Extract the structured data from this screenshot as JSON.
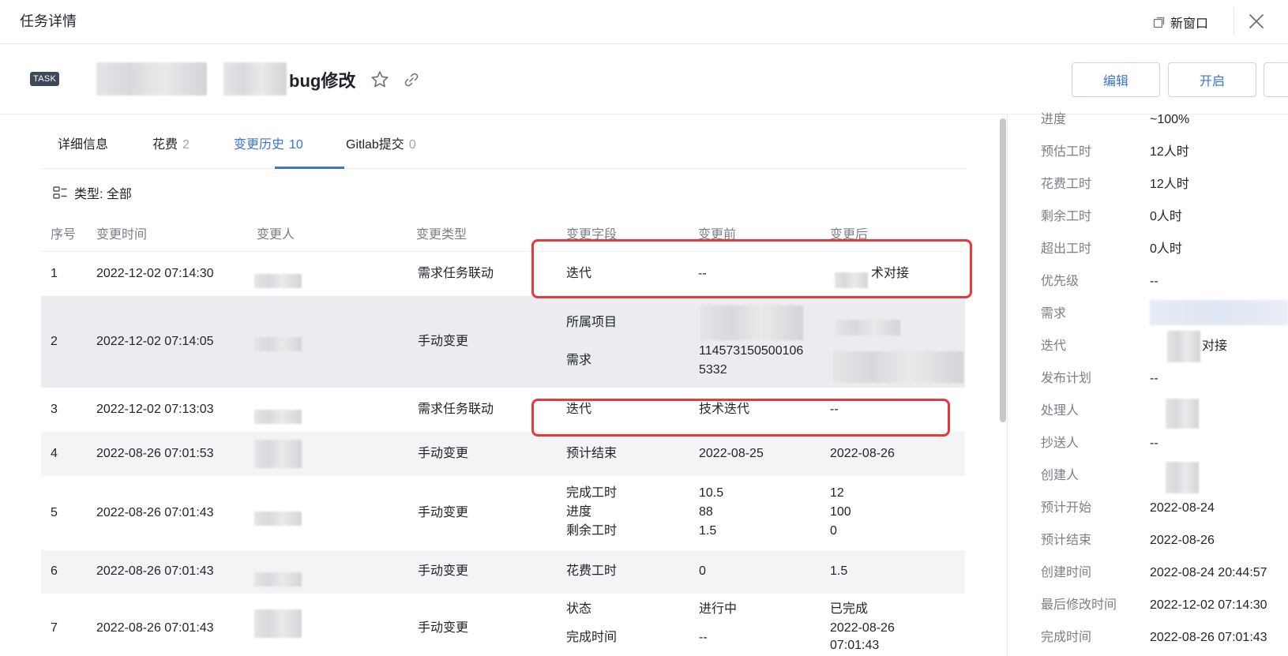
{
  "header": {
    "title": "任务详情",
    "new_window": "新窗口"
  },
  "task": {
    "tag": "TASK",
    "name_suffix": "bug修改"
  },
  "actions": {
    "edit": "编辑",
    "open": "开启"
  },
  "tabs": [
    {
      "label": "详细信息",
      "count": ""
    },
    {
      "label": "花费",
      "count": "2"
    },
    {
      "label": "变更历史",
      "count": "10"
    },
    {
      "label": "Gitlab提交",
      "count": "0"
    }
  ],
  "filter": {
    "label": "类型: 全部"
  },
  "table": {
    "headers": [
      "序号",
      "变更时间",
      "变更人",
      "变更类型",
      "变更字段",
      "变更前",
      "变更后"
    ],
    "rows": [
      {
        "no": "1",
        "time": "2022-12-02 07:14:30",
        "type": "需求任务联动",
        "fields": [
          "迭代"
        ],
        "before": [
          "--"
        ],
        "after": [
          "术对接"
        ]
      },
      {
        "no": "2",
        "time": "2022-12-02 07:14:05",
        "type": "手动变更",
        "fields": [
          "所属项目",
          "需求"
        ],
        "before": [
          "",
          "114573150500106",
          "5332"
        ],
        "after": [
          "",
          ""
        ]
      },
      {
        "no": "3",
        "time": "2022-12-02 07:13:03",
        "type": "需求任务联动",
        "fields": [
          "迭代"
        ],
        "before": [
          "技术迭代"
        ],
        "after": [
          "--"
        ]
      },
      {
        "no": "4",
        "time": "2022-08-26 07:01:53",
        "type": "手动变更",
        "fields": [
          "预计结束"
        ],
        "before": [
          "2022-08-25"
        ],
        "after": [
          "2022-08-26"
        ]
      },
      {
        "no": "5",
        "time": "2022-08-26 07:01:43",
        "type": "手动变更",
        "fields": [
          "完成工时",
          "进度",
          "剩余工时"
        ],
        "before": [
          "10.5",
          "88",
          "1.5"
        ],
        "after": [
          "12",
          "100",
          "0"
        ]
      },
      {
        "no": "6",
        "time": "2022-08-26 07:01:43",
        "type": "手动变更",
        "fields": [
          "花费工时"
        ],
        "before": [
          "0"
        ],
        "after": [
          "1.5"
        ]
      },
      {
        "no": "7",
        "time": "2022-08-26 07:01:43",
        "type": "手动变更",
        "fields": [
          "状态",
          "完成时间"
        ],
        "before": [
          "进行中",
          "--"
        ],
        "after": [
          "已完成",
          "2022-08-26",
          "07:01:43"
        ]
      }
    ]
  },
  "properties": [
    {
      "label": "进度",
      "value": "~100%"
    },
    {
      "label": "预估工时",
      "value": "12人时"
    },
    {
      "label": "花费工时",
      "value": "12人时"
    },
    {
      "label": "剩余工时",
      "value": "0人时"
    },
    {
      "label": "超出工时",
      "value": "0人时"
    },
    {
      "label": "优先级",
      "value": "--"
    },
    {
      "label": "需求",
      "value": ""
    },
    {
      "label": "迭代",
      "value": "对接"
    },
    {
      "label": "发布计划",
      "value": "--"
    },
    {
      "label": "处理人",
      "value": ""
    },
    {
      "label": "抄送人",
      "value": "--"
    },
    {
      "label": "创建人",
      "value": ""
    },
    {
      "label": "预计开始",
      "value": "2022-08-24"
    },
    {
      "label": "预计结束",
      "value": "2022-08-26"
    },
    {
      "label": "创建时间",
      "value": "2022-08-24 20:44:57"
    },
    {
      "label": "最后修改时间",
      "value": "2022-12-02 07:14:30"
    },
    {
      "label": "完成时间",
      "value": "2022-08-26 07:01:43"
    }
  ],
  "colors": {
    "accent": "#3a73d9",
    "highlight_box": "#e5393b",
    "task_tag": "#3c4a5c"
  }
}
